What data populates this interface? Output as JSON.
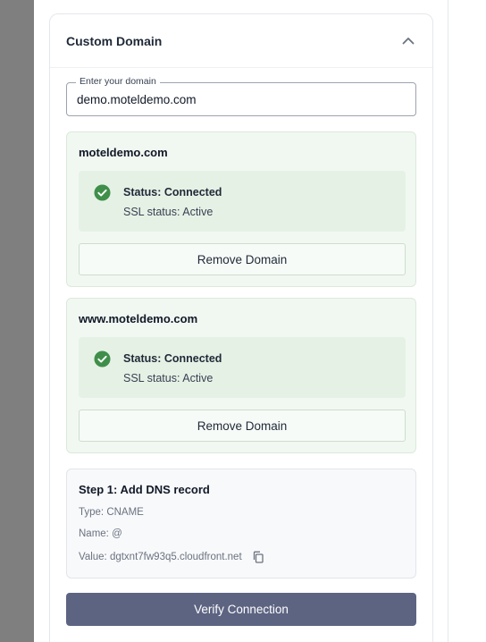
{
  "section": {
    "title": "Custom Domain",
    "toggle_icon": "chevron-up-icon"
  },
  "domain_input": {
    "label": "Enter your domain",
    "value": "demo.moteldemo.com"
  },
  "domains": [
    {
      "name": "moteldemo.com",
      "status": "Status: Connected",
      "ssl": "SSL status: Active",
      "remove_label": "Remove Domain"
    },
    {
      "name": "www.moteldemo.com",
      "status": "Status: Connected",
      "ssl": "SSL status: Active",
      "remove_label": "Remove Domain"
    }
  ],
  "dns": {
    "title": "Step 1: Add DNS record",
    "type": "Type: CNAME",
    "name": "Name: @",
    "value": "Value: dgtxnt7fw93q5.cloudfront.net",
    "copy_icon": "copy-icon"
  },
  "verify_label": "Verify Connection",
  "colors": {
    "success": "#3f8f4a",
    "primary_button": "#5d6482",
    "domain_bg": "#f1f8f1"
  }
}
